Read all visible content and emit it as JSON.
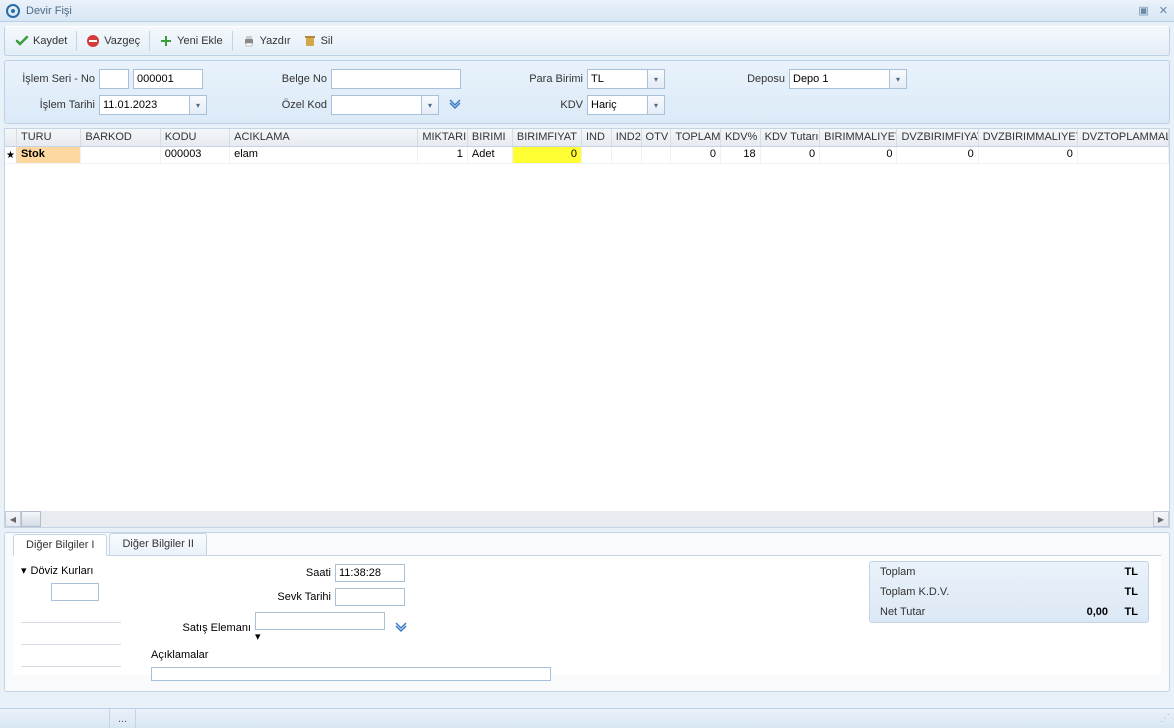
{
  "window": {
    "title": "Devir Fişi"
  },
  "toolbar": {
    "save": "Kaydet",
    "cancel": "Vazgeç",
    "add": "Yeni Ekle",
    "print": "Yazdır",
    "delete": "Sil"
  },
  "form": {
    "seri_label": "İşlem  Seri - No",
    "seri_value": "000001",
    "tarih_label": "İşlem Tarihi",
    "tarih_value": "11.01.2023",
    "belge_label": "Belge No",
    "belge_value": "",
    "ozelkod_label": "Özel Kod",
    "ozelkod_value": "",
    "para_label": "Para Birimi",
    "para_value": "TL",
    "kdv_label": "KDV",
    "kdv_value": "Hariç",
    "depo_label": "Deposu",
    "depo_value": "Depo 1"
  },
  "grid": {
    "cols": [
      "TURU",
      "BARKOD",
      "KODU",
      "ACIKLAMA",
      "MIKTARI",
      "BIRIMI",
      "BIRIMFIYAT",
      "IND",
      "IND2",
      "OTV",
      "TOPLAM",
      "KDV%",
      "KDV Tutarı",
      "BIRIMMALIYET",
      "DVZBIRIMFIYAT",
      "DVZBIRIMMALIYETI",
      "DVZTOPLAMMALIY"
    ],
    "row": {
      "turu": "Stok",
      "barkod": "",
      "kodu": "000003",
      "aciklama": "elam",
      "miktari": "1",
      "birimi": "Adet",
      "birimfiyat": "0",
      "ind": "",
      "ind2": "",
      "otv": "",
      "toplam": "0",
      "kdvp": "18",
      "kdvtut": "0",
      "birimmaliyet": "0",
      "dvzbirimfiyat": "0",
      "dvzbirimmaliyeti": "0",
      "dvztoplammaliy": ""
    }
  },
  "tabs": {
    "t1": "Diğer Bilgiler I",
    "t2": "Diğer Bilgiler II",
    "doviz": "Döviz Kurları",
    "saati_label": "Saati",
    "saati_value": "11:38:28",
    "sevk_label": "Sevk Tarihi",
    "sevk_value": "",
    "satis_label": "Satış Elemanı",
    "satis_value": "",
    "aciklama_label": "Açıklamalar",
    "aciklama_value": ""
  },
  "totals": {
    "toplam_label": "Toplam",
    "toplam_value": "",
    "toplam_cur": "TL",
    "kdv_label": "Toplam K.D.V.",
    "kdv_value": "",
    "kdv_cur": "TL",
    "net_label": "Net Tutar",
    "net_value": "0,00",
    "net_cur": "TL"
  },
  "statusbar": {
    "dots": "..."
  }
}
